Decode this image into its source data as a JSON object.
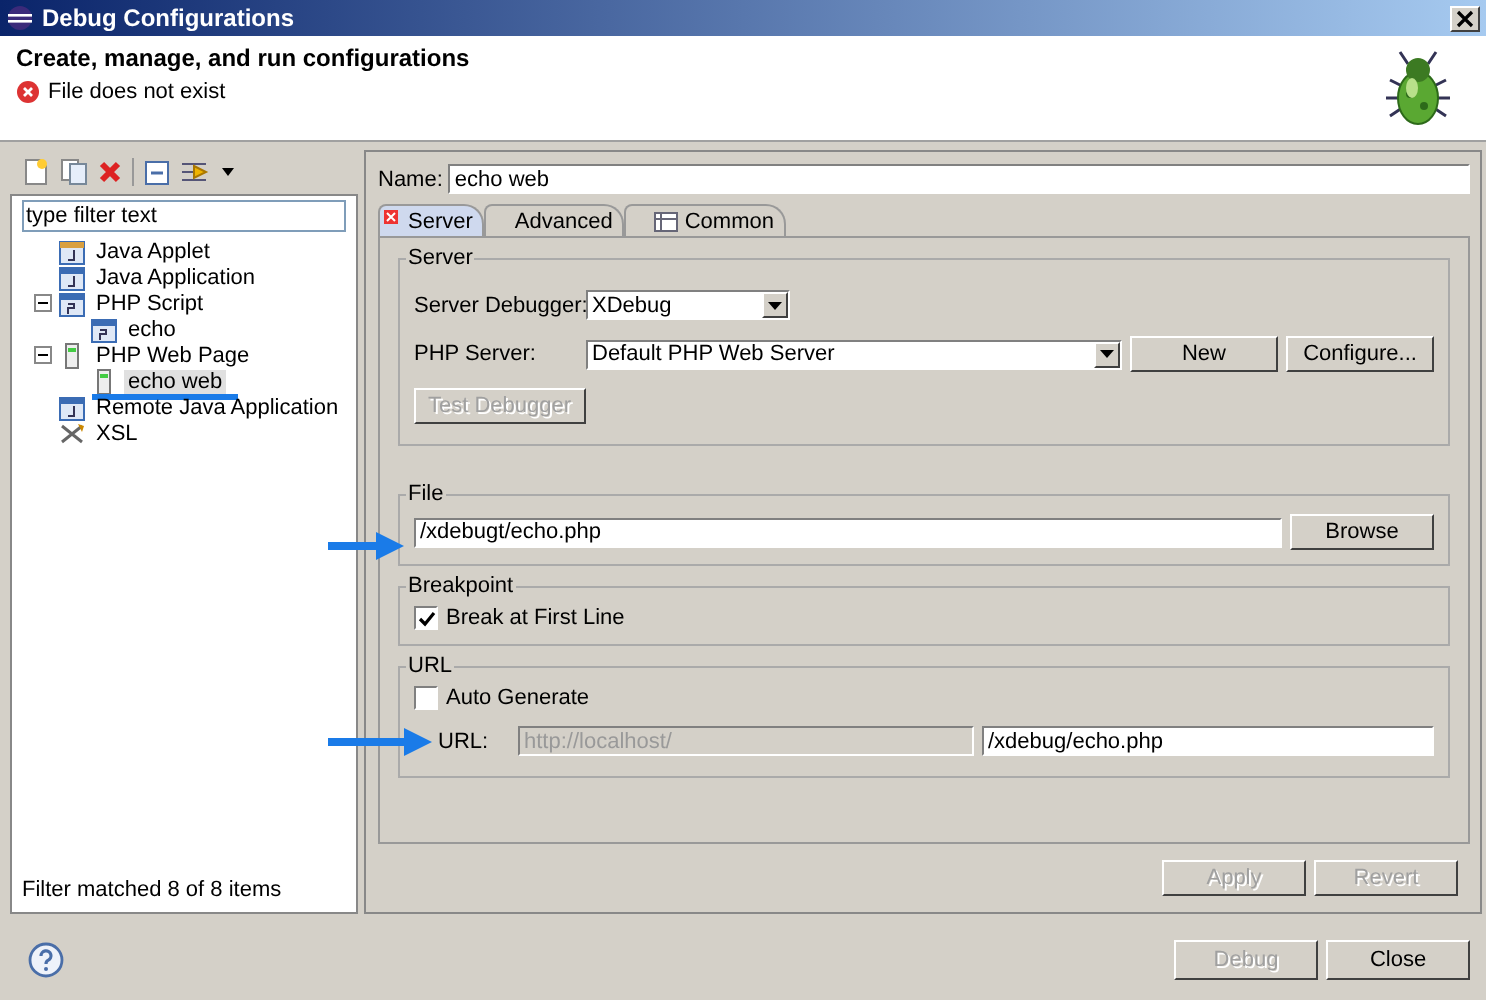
{
  "window": {
    "title": "Debug Configurations"
  },
  "header": {
    "title": "Create, manage, and run configurations",
    "message": "File does not exist",
    "kind": "error"
  },
  "filter": {
    "value": "type filter text"
  },
  "tree": [
    {
      "label": "Java Applet",
      "kind": "applet",
      "selected": false
    },
    {
      "label": "Java Application",
      "kind": "java",
      "selected": false
    },
    {
      "label": "PHP Script",
      "kind": "php",
      "selected": false,
      "expanded": true,
      "children": [
        {
          "label": "echo",
          "kind": "php",
          "selected": false
        }
      ]
    },
    {
      "label": "PHP Web Page",
      "kind": "web",
      "selected": false,
      "expanded": true,
      "children": [
        {
          "label": "echo web",
          "kind": "web",
          "selected": true
        }
      ]
    },
    {
      "label": "Remote Java Application",
      "kind": "remote",
      "selected": false
    },
    {
      "label": "XSL",
      "kind": "xsl",
      "selected": false
    }
  ],
  "filter_status": "Filter matched 8 of 8 items",
  "name": {
    "label": "Name:",
    "value": "echo web"
  },
  "tabs": [
    {
      "label": "Server",
      "selected": true,
      "error": true
    },
    {
      "label": "Advanced",
      "selected": false,
      "error": false
    },
    {
      "label": "Common",
      "selected": false,
      "error": false
    }
  ],
  "server": {
    "title": "Server",
    "debugger_label": "Server Debugger:",
    "debugger": "XDebug",
    "php_server_label": "PHP Server:",
    "php_server": "Default PHP Web Server",
    "buttons": [
      {
        "label": "New",
        "disabled": false
      },
      {
        "label": "Configure...",
        "disabled": false
      }
    ],
    "test_button": {
      "label": "Test Debugger",
      "disabled": true
    }
  },
  "file": {
    "title": "File",
    "value": "/xdebugt/echo.php",
    "button": {
      "label": "Browse",
      "disabled": false
    }
  },
  "breakpoint": {
    "title": "Breakpoint",
    "label": "Break at First Line",
    "checked": true
  },
  "url": {
    "title": "URL",
    "auto_label": "Auto Generate",
    "auto_checked": false,
    "url_label": "URL:",
    "prefix": "http://localhost/",
    "prefix_disabled": true,
    "path": "/xdebug/echo.php"
  },
  "form_buttons": [
    {
      "label": "Apply",
      "disabled": true
    },
    {
      "label": "Revert",
      "disabled": true
    }
  ],
  "dialog_buttons": [
    {
      "label": "Debug",
      "disabled": true
    },
    {
      "label": "Close",
      "disabled": false
    }
  ]
}
